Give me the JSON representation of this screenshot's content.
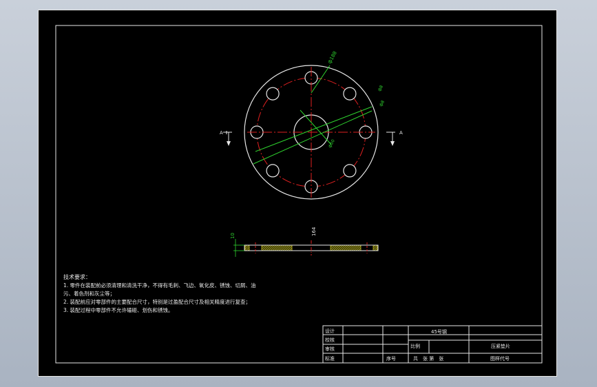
{
  "tech_requirements": {
    "heading": "技术要求：",
    "lines": [
      "1. 零件在装配前必须清理和清洗干净，不得有毛刺、飞边、氧化皮、锈蚀、切屑、油",
      "污、着色剂和灰尘等；",
      "2. 装配前应对零部件的主要配合尺寸，特别是过盈配合尺寸及相关精度进行复查；",
      "3. 装配过程中零部件不允许磕碰、划伤和锈蚀。"
    ]
  },
  "dimensions": {
    "d1": "ф188",
    "d2": "ф8",
    "d3": "ф8",
    "d4": "ф50",
    "thickness": "10",
    "width": "164"
  },
  "section_markers": {
    "left": "A",
    "right": "A"
  },
  "title_block": {
    "design": "设计",
    "check": "校核",
    "review": "审核",
    "standard": "标准",
    "seq_no": "序号",
    "material": "45号钢",
    "scale": "比例",
    "part_name": "压紧垫片",
    "sheets": "共　张  第　张",
    "drawing_no": "图样代号"
  },
  "colors": {
    "background": "#000000",
    "outline": "#e8e8e8",
    "centerline": "#e02020",
    "dimension": "#2fd42f",
    "hatch": "#c8c020"
  }
}
